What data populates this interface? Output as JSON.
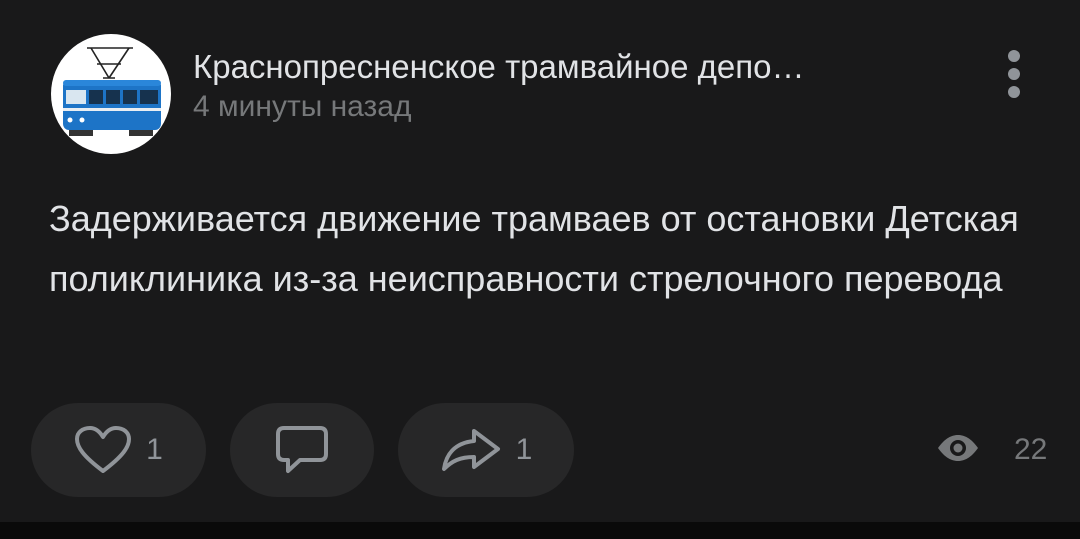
{
  "post": {
    "author": "Краснопресненское трамвайное депо…",
    "time": "4 минуты назад",
    "text": "Задерживается движение трамваев от остановки Детская поликлиника из-за неисправности стрелочного перевода",
    "avatar_icon": "tram-icon"
  },
  "actions": {
    "like_count": "1",
    "share_count": "1",
    "views_count": "22"
  },
  "colors": {
    "background": "#19191a",
    "pill": "#272728",
    "text_primary": "#e1e3e6",
    "text_secondary": "#76787a",
    "tram_blue": "#1d74c7"
  }
}
